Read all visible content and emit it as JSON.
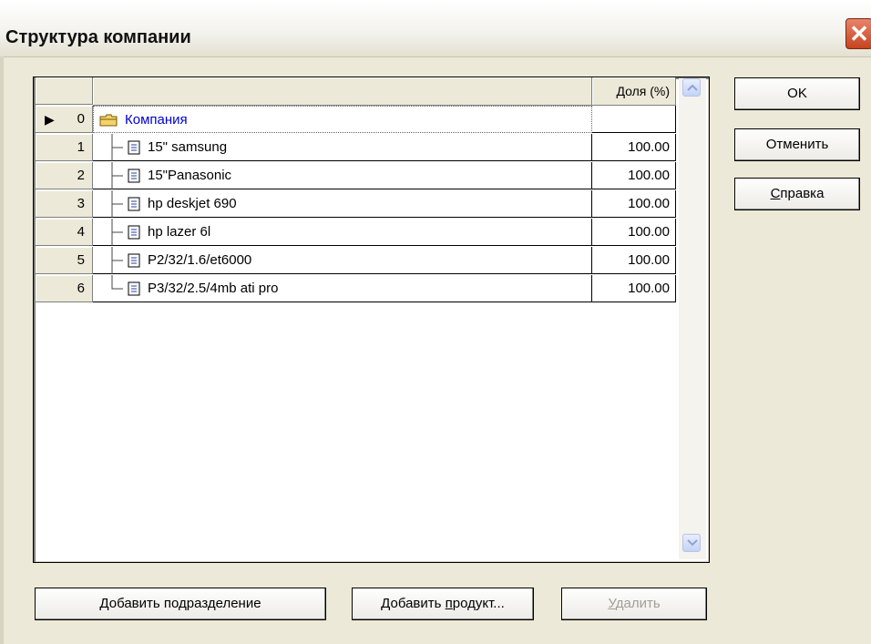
{
  "window": {
    "title": "Структура компании",
    "close_glyph": "✕"
  },
  "grid": {
    "columns": {
      "name": "",
      "share": "Доля (%)"
    },
    "root": {
      "index": "0",
      "label": "Компания",
      "share": "",
      "indicator": "▶"
    },
    "items": [
      {
        "index": "1",
        "label": "15\" samsung",
        "share": "100.00"
      },
      {
        "index": "2",
        "label": "15\"Panasonic",
        "share": "100.00"
      },
      {
        "index": "3",
        "label": "hp deskjet 690",
        "share": "100.00"
      },
      {
        "index": "4",
        "label": "hp lazer 6l",
        "share": "100.00"
      },
      {
        "index": "5",
        "label": "P2/32/1.6/et6000",
        "share": "100.00"
      },
      {
        "index": "6",
        "label": "P3/32/2.5/4mb ati pro",
        "share": "100.00"
      }
    ]
  },
  "buttons": {
    "ok": "OK",
    "cancel": "Отменить",
    "help": {
      "mnemonic": "С",
      "rest": "правка"
    },
    "add_division": {
      "pre": "Добавить по",
      "mnemonic": "д",
      "post": "разделение"
    },
    "add_product": {
      "pre": "Добавить ",
      "mnemonic": "п",
      "post": "родукт..."
    },
    "delete": {
      "mnemonic": "У",
      "rest": "далить"
    }
  },
  "colors": {
    "root_label": "#0000d0",
    "disabled": "#a09e95",
    "close": "#c8431f"
  },
  "icons": {
    "root": "folder-icon",
    "item": "document-icon",
    "scroll_up": "chevron-up-icon",
    "scroll_down": "chevron-down-icon"
  }
}
